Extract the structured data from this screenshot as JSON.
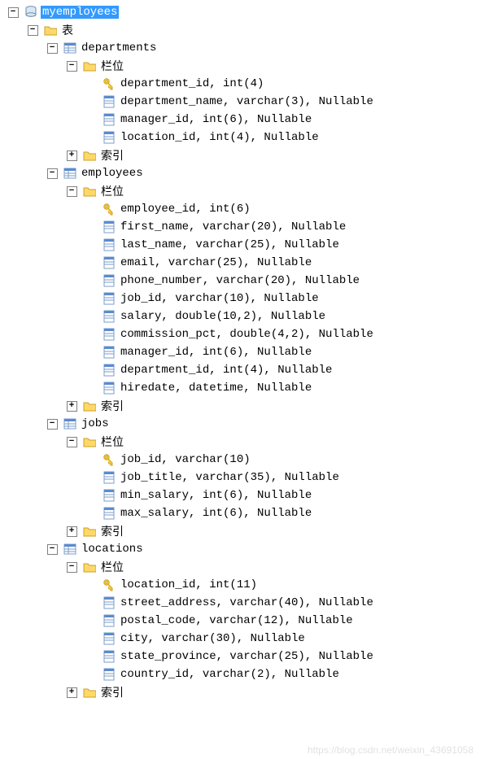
{
  "database": {
    "name": "myemployees",
    "tables_label": "表",
    "columns_label": "栏位",
    "indexes_label": "索引",
    "tables": [
      {
        "name": "departments",
        "columns": [
          {
            "pk": true,
            "text": "department_id, int(4)"
          },
          {
            "pk": false,
            "text": "department_name, varchar(3), Nullable"
          },
          {
            "pk": false,
            "text": "manager_id, int(6), Nullable"
          },
          {
            "pk": false,
            "text": "location_id, int(4), Nullable"
          }
        ]
      },
      {
        "name": "employees",
        "columns": [
          {
            "pk": true,
            "text": "employee_id, int(6)"
          },
          {
            "pk": false,
            "text": "first_name, varchar(20), Nullable"
          },
          {
            "pk": false,
            "text": "last_name, varchar(25), Nullable"
          },
          {
            "pk": false,
            "text": "email, varchar(25), Nullable"
          },
          {
            "pk": false,
            "text": "phone_number, varchar(20), Nullable"
          },
          {
            "pk": false,
            "text": "job_id, varchar(10), Nullable"
          },
          {
            "pk": false,
            "text": "salary, double(10,2), Nullable"
          },
          {
            "pk": false,
            "text": "commission_pct, double(4,2), Nullable"
          },
          {
            "pk": false,
            "text": "manager_id, int(6), Nullable"
          },
          {
            "pk": false,
            "text": "department_id, int(4), Nullable"
          },
          {
            "pk": false,
            "text": "hiredate, datetime, Nullable"
          }
        ]
      },
      {
        "name": "jobs",
        "columns": [
          {
            "pk": true,
            "text": "job_id, varchar(10)"
          },
          {
            "pk": false,
            "text": "job_title, varchar(35), Nullable"
          },
          {
            "pk": false,
            "text": "min_salary, int(6), Nullable"
          },
          {
            "pk": false,
            "text": "max_salary, int(6), Nullable"
          }
        ]
      },
      {
        "name": "locations",
        "columns": [
          {
            "pk": true,
            "text": "location_id, int(11)"
          },
          {
            "pk": false,
            "text": "street_address, varchar(40), Nullable"
          },
          {
            "pk": false,
            "text": "postal_code, varchar(12), Nullable"
          },
          {
            "pk": false,
            "text": "city, varchar(30), Nullable"
          },
          {
            "pk": false,
            "text": "state_province, varchar(25), Nullable"
          },
          {
            "pk": false,
            "text": "country_id, varchar(2), Nullable"
          }
        ]
      }
    ]
  },
  "watermark": "https://blog.csdn.net/weixin_43691058"
}
